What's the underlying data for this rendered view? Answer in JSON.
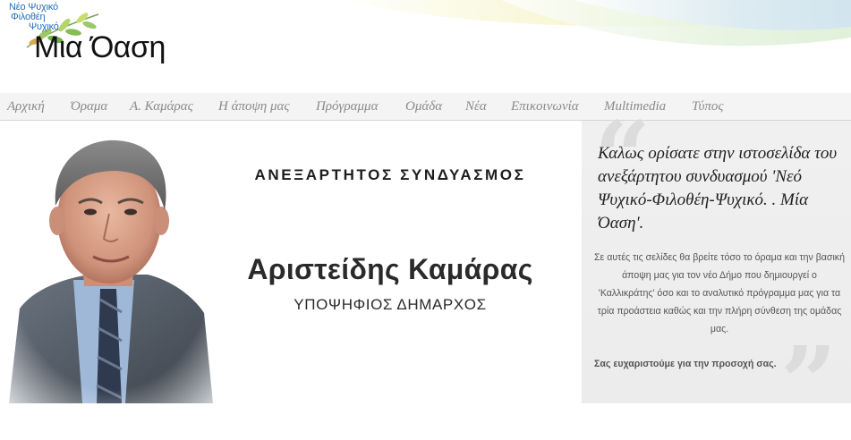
{
  "logo": {
    "line1": "Νέο Ψυχικό",
    "line2": "Φιλοθέη",
    "line3": "Ψυχικό",
    "main": "Μια Όαση"
  },
  "nav": {
    "items": [
      "Αρχική",
      "Όραμα",
      "Α. Καμάρας",
      "Η άποψη μας",
      "Πρόγραμμα",
      "Ομάδα",
      "Νέα",
      "Επικοινωνία",
      "Multimedia",
      "Τύπος"
    ]
  },
  "hero": {
    "slogan": "ΑΝΕΞΑΡΤΗΤΟΣ ΣΥΝΔΥΑΣΜΟΣ",
    "name": "Αριστείδης Καμάρας",
    "role": "ΥΠΟΨΗΦΙΟΣ ΔΗΜΑΡΧΟΣ"
  },
  "welcome": {
    "title": "Καλως ορίσατε στην ιστοσελίδα του ανεξάρτητου συνδυασμού 'Νεό Ψυχικό-Φιλοθέη-Ψυχικό. . Μία Όαση'.",
    "body": "Σε αυτές τις σελίδες θα βρείτε τόσο το όραμα και την βασική άποψη μας για τον νέο Δήμο που δημιουργεί ο 'Καλλικράτης' όσο και το αναλυτικό πρόγραμμα μας για τα τρία προάστεια καθώς και την πλήρη σύνθεση της ομάδας μας.",
    "thanks": "Σας ευχαριστούμε για την προσοχή σας."
  },
  "colors": {
    "nav_bg": "#f4f4f4",
    "nav_text": "#8a8a8a",
    "logo_blue": "#2a6fb5",
    "panel_bg": "#efefef"
  }
}
